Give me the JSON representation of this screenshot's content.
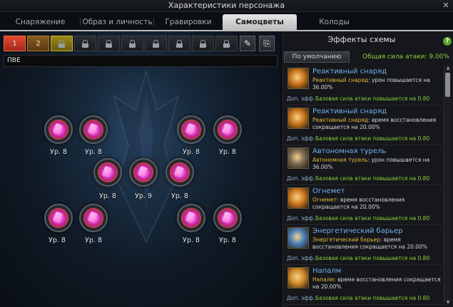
{
  "window": {
    "title": "Характеристики персонажа",
    "close_glyph": "✕"
  },
  "tabs": [
    {
      "label": "Снаряжение"
    },
    {
      "label": "Образ и личность"
    },
    {
      "label": "Гравировки"
    },
    {
      "label": "Самоцветы",
      "active": true
    },
    {
      "label": "Колоды"
    }
  ],
  "slots": [
    {
      "label": "1",
      "state": "active"
    },
    {
      "label": "2",
      "state": "normal"
    },
    {
      "icon": "lock-icon",
      "state": "locked-gold"
    },
    {
      "icon": "lock-icon",
      "state": "locked"
    },
    {
      "icon": "lock-icon",
      "state": "locked"
    },
    {
      "icon": "lock-icon",
      "state": "locked"
    },
    {
      "icon": "lock-icon",
      "state": "locked"
    },
    {
      "icon": "lock-icon",
      "state": "locked"
    },
    {
      "icon": "lock-icon",
      "state": "locked"
    },
    {
      "icon": "lock-icon",
      "state": "locked"
    }
  ],
  "tools": {
    "edit_icon": "edit-icon",
    "edit_glyph": "✎",
    "save_icon": "save-icon",
    "save_glyph": "⎘"
  },
  "preset_name": "ПВЕ",
  "gems": [
    {
      "level": "Ур. 8"
    },
    {
      "level": "Ур. 8"
    },
    {
      "level": "Ур. 8"
    },
    {
      "level": "Ур. 8"
    },
    {
      "level": "Ур. 8"
    },
    {
      "level": "Ур. 9"
    },
    {
      "level": "Ур. 8"
    },
    {
      "level": "Ур. 8"
    },
    {
      "level": "Ур. 8"
    },
    {
      "level": "Ур. 8"
    },
    {
      "level": "Ур. 8"
    }
  ],
  "effects_panel": {
    "title": "Эффекты схемы",
    "help_glyph": "?",
    "default_button": "По умолчанию",
    "total": "Общая сила атаки: 9.00%",
    "extra_label": "Доп. эфф.",
    "items": [
      {
        "name": "Реактивный снаряд",
        "skill": "Реактивный снаряд",
        "desc": ": урон повышается на 36.00%",
        "extra": "Базовая сила атаки повышается на 0.80",
        "icon": "rocket-icon",
        "icon_color": "#c8751a"
      },
      {
        "name": "Реактивный снаряд",
        "skill": "Реактивный снаряд",
        "desc": ": время восстановления сокращается на 20.00%",
        "extra": "Базовая сила атаки повышается на 0.80",
        "icon": "rocket-icon",
        "icon_color": "#c8751a"
      },
      {
        "name": "Автономная турель",
        "skill": "Автономная турель",
        "desc": ": урон повышается на 36.00%",
        "extra": "Базовая сила атаки повышается на 0.80",
        "icon": "turret-icon",
        "icon_color": "#7a6a55"
      },
      {
        "name": "Огнемет",
        "skill": "Огнемет",
        "desc": ": время восстановления сокращается на 20.00%",
        "extra": "Базовая сила атаки повышается на 0.80",
        "icon": "flamethrower-icon",
        "icon_color": "#d07a1e"
      },
      {
        "name": "Энергетический барьер",
        "skill": "Энергетический барьер",
        "desc": ": время восстановления сокращается на 20.00%",
        "extra": "Базовая сила атаки повышается на 0.80",
        "icon": "barrier-icon",
        "icon_color": "#4a7fb8"
      },
      {
        "name": "Напалм",
        "skill": "Напалм",
        "desc": ": время восстановления сокращается на 20.00%",
        "extra": "Базовая сила атаки повышается на 0.80",
        "icon": "napalm-icon",
        "icon_color": "#d08a2a"
      }
    ]
  },
  "scroll": {
    "up_glyph": "▲",
    "down_glyph": "▼"
  }
}
